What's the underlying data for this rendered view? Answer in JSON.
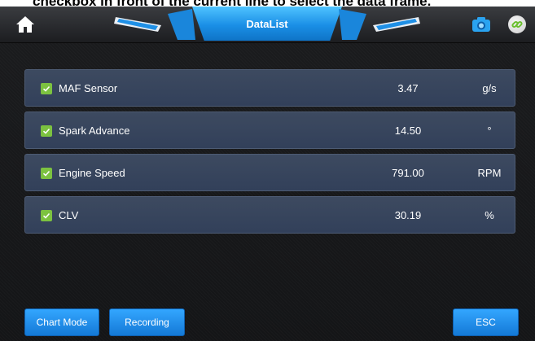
{
  "caption": "checkbox in front of the current line to select the data frame.",
  "header": {
    "title": "DataList",
    "icons": {
      "home": "home-icon",
      "camera": "camera-icon",
      "link": "link-icon"
    }
  },
  "rows": [
    {
      "name": "MAF Sensor",
      "value": "3.47",
      "unit": "g/s",
      "checked": true
    },
    {
      "name": "Spark Advance",
      "value": "14.50",
      "unit": "°",
      "checked": true
    },
    {
      "name": "Engine Speed",
      "value": "791.00",
      "unit": "RPM",
      "checked": true
    },
    {
      "name": "CLV",
      "value": "30.19",
      "unit": "%",
      "checked": true
    }
  ],
  "buttons": {
    "chart_mode": "Chart Mode",
    "recording": "Recording",
    "esc": "ESC"
  },
  "colors": {
    "accent": "#1a8fe6",
    "row_bg": "#36445c",
    "check": "#7cc240"
  }
}
